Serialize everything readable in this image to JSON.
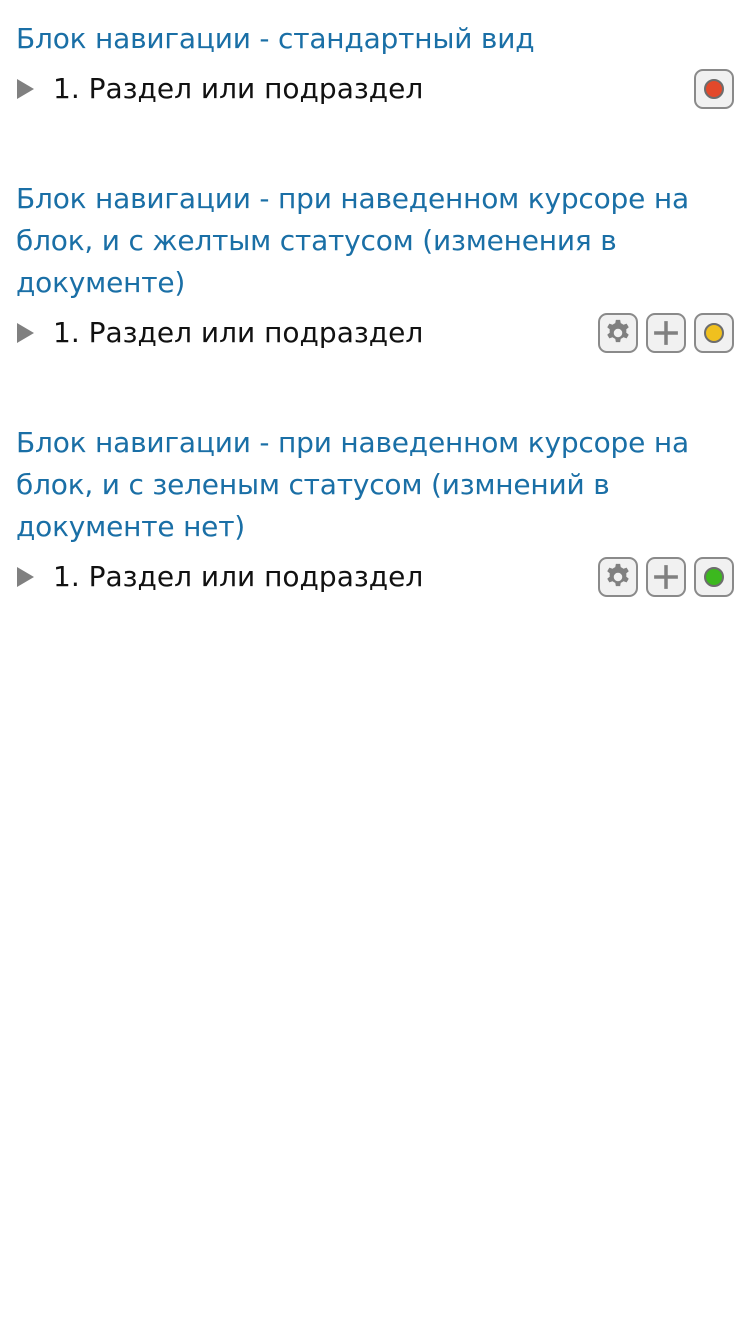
{
  "sections": [
    {
      "title": "Блок навигации - стандартный вид",
      "item_label": "1. Раздел или подраздел",
      "status_color": "#e2492b",
      "show_actions": false
    },
    {
      "title_lines": [
        "Блок навигации - при наведенном курсоре на",
        "блок, и с желтым статусом (изменения в",
        "документе)"
      ],
      "item_label": "1. Раздел или подраздел",
      "status_color": "#f0c01e",
      "show_actions": true
    },
    {
      "title_lines": [
        "Блок навигации - при наведенном курсоре на",
        "блок, и с зеленым статусом (измнений в",
        "документе нет)"
      ],
      "item_label": "1. Раздел или подраздел",
      "status_color": "#3cb81e",
      "show_actions": true
    }
  ],
  "icons": {
    "expand": "triangle-right-icon",
    "settings": "gear-icon",
    "add": "plus-icon",
    "status": "status-dot-icon"
  },
  "colors": {
    "title": "#1a6fa6",
    "label": "#111111",
    "icon": "#808080"
  }
}
